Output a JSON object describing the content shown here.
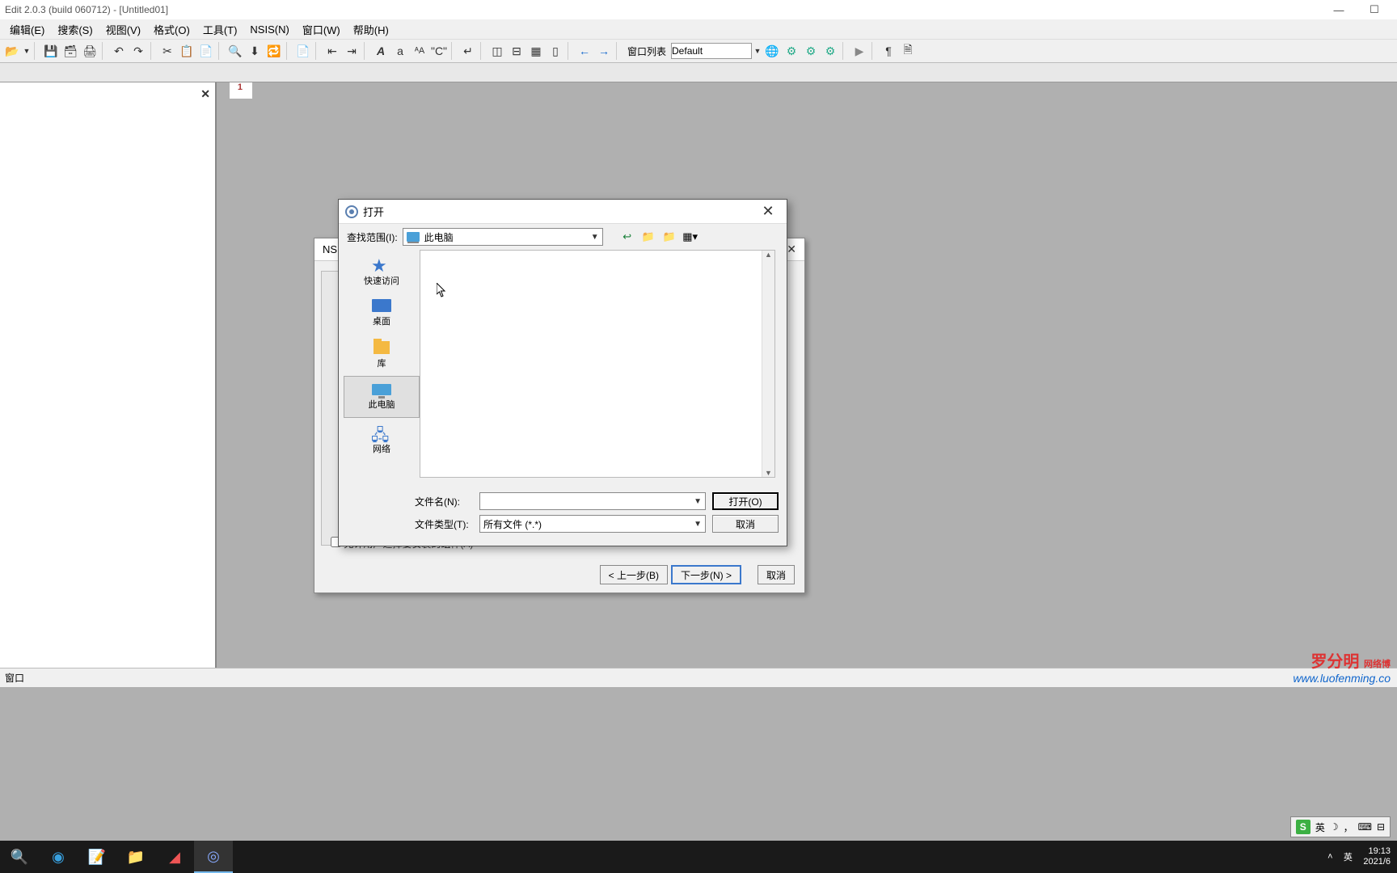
{
  "title": "Edit 2.0.3 (build 060712) - [Untitled01]",
  "menu": {
    "edit": "编辑(E)",
    "search": "搜索(S)",
    "view": "视图(V)",
    "format": "格式(O)",
    "tools": "工具(T)",
    "nsis": "NSIS(N)",
    "window": "窗口(W)",
    "help": "帮助(H)"
  },
  "toolbar": {
    "winlist": "窗口列表",
    "default": "Default"
  },
  "gutter": {
    "line1": "1"
  },
  "statusbar": {
    "left": "窗口"
  },
  "wizard": {
    "title": "NSIS",
    "checkbox": "允许用户选择要安装的组件(A)",
    "back": "< 上一步(B)",
    "next": "下一步(N) >",
    "cancel": "取消"
  },
  "opendlg": {
    "title": "打开",
    "lookin_label": "查找范围(I):",
    "lookin_value": "此电脑",
    "places": {
      "quick": "快速访问",
      "desktop": "桌面",
      "library": "库",
      "thispc": "此电脑",
      "network": "网络"
    },
    "filename_label": "文件名(N):",
    "filename_value": "",
    "filetype_label": "文件类型(T):",
    "filetype_value": "所有文件 (*.*)",
    "open_btn": "打开(O)",
    "cancel_btn": "取消"
  },
  "watermark": {
    "l1a": "罗分明",
    "l1b": "网络博",
    "l2": "www.luofenming.co"
  },
  "ime": {
    "lang1": "英",
    "lang2": "英"
  },
  "tray": {
    "time": "19:13",
    "date": "2021/6"
  }
}
